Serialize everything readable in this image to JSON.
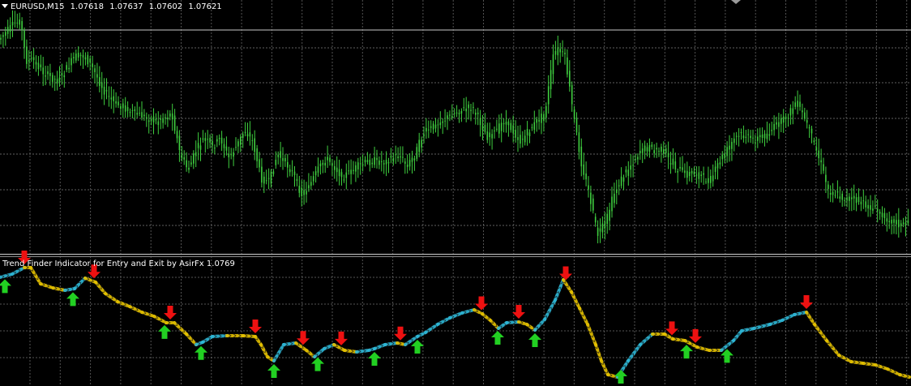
{
  "window": {
    "symbol_timeframe": "EURUSD,M15",
    "open": "1.07618",
    "high": "1.07637",
    "low": "1.07602",
    "close": "1.07621"
  },
  "indicator": {
    "label": "Trend Finder Indicator for Entry and Exit by AsirFx 1.0769"
  },
  "colors": {
    "background": "#000000",
    "grid": "#8a8a8a",
    "candles": "#3fcf3f",
    "uptrend_line": "#2eb8d8",
    "downtrend_line": "#e6c200",
    "buy_arrow": "#22d022",
    "sell_arrow": "#ee1111"
  },
  "chart_data": [
    {
      "type": "line",
      "title": "EURUSD,M15",
      "x_note": "bar index (left to right)",
      "series": [
        {
          "name": "EURUSD,M15",
          "values": [
            [
              0,
              50
            ],
            [
              10,
              40
            ],
            [
              20,
              30
            ],
            [
              28,
              25
            ],
            [
              35,
              75
            ],
            [
              45,
              75
            ],
            [
              55,
              88
            ],
            [
              65,
              95
            ],
            [
              75,
              100
            ],
            [
              85,
              85
            ],
            [
              95,
              70
            ],
            [
              105,
              68
            ],
            [
              115,
              80
            ],
            [
              125,
              100
            ],
            [
              135,
              118
            ],
            [
              145,
              128
            ],
            [
              155,
              132
            ],
            [
              165,
              138
            ],
            [
              175,
              142
            ],
            [
              185,
              145
            ],
            [
              195,
              150
            ],
            [
              205,
              145
            ],
            [
              215,
              140
            ],
            [
              225,
              190
            ],
            [
              235,
              210
            ],
            [
              245,
              185
            ],
            [
              255,
              170
            ],
            [
              265,
              182
            ],
            [
              275,
              170
            ],
            [
              285,
              195
            ],
            [
              295,
              180
            ],
            [
              305,
              160
            ],
            [
              315,
              175
            ],
            [
              325,
              220
            ],
            [
              335,
              225
            ],
            [
              345,
              190
            ],
            [
              355,
              200
            ],
            [
              365,
              215
            ],
            [
              375,
              240
            ],
            [
              385,
              228
            ],
            [
              395,
              210
            ],
            [
              405,
              195
            ],
            [
              415,
              205
            ],
            [
              425,
              218
            ],
            [
              435,
              212
            ],
            [
              445,
              205
            ],
            [
              455,
              200
            ],
            [
              465,
              198
            ],
            [
              475,
              200
            ],
            [
              485,
              196
            ],
            [
              495,
              190
            ],
            [
              505,
              205
            ],
            [
              515,
              190
            ],
            [
              525,
              165
            ],
            [
              535,
              158
            ],
            [
              545,
              150
            ],
            [
              555,
              145
            ],
            [
              565,
              138
            ],
            [
              575,
              135
            ],
            [
              585,
              132
            ],
            [
              595,
              150
            ],
            [
              605,
              170
            ],
            [
              615,
              162
            ],
            [
              625,
              148
            ],
            [
              635,
              160
            ],
            [
              645,
              175
            ],
            [
              655,
              162
            ],
            [
              665,
              150
            ],
            [
              675,
              140
            ],
            [
              685,
              72
            ],
            [
              690,
              60
            ],
            [
              700,
              70
            ],
            [
              710,
              140
            ],
            [
              720,
              200
            ],
            [
              730,
              240
            ],
            [
              740,
              290
            ],
            [
              750,
              275
            ],
            [
              760,
              240
            ],
            [
              770,
              220
            ],
            [
              780,
              205
            ],
            [
              790,
              190
            ],
            [
              800,
              182
            ],
            [
              810,
              185
            ],
            [
              820,
              185
            ],
            [
              830,
              200
            ],
            [
              840,
              210
            ],
            [
              850,
              215
            ],
            [
              860,
              212
            ],
            [
              870,
              220
            ],
            [
              880,
              222
            ],
            [
              890,
              200
            ],
            [
              900,
              185
            ],
            [
              910,
              170
            ],
            [
              920,
              165
            ],
            [
              930,
              172
            ],
            [
              940,
              170
            ],
            [
              950,
              165
            ],
            [
              960,
              155
            ],
            [
              970,
              148
            ],
            [
              980,
              135
            ],
            [
              985,
              125
            ],
            [
              995,
              145
            ],
            [
              1005,
              170
            ],
            [
              1015,
              200
            ],
            [
              1025,
              235
            ],
            [
              1035,
              240
            ],
            [
              1045,
              245
            ],
            [
              1055,
              245
            ],
            [
              1065,
              250
            ],
            [
              1075,
              255
            ],
            [
              1085,
              260
            ],
            [
              1095,
              268
            ],
            [
              1105,
              272
            ],
            [
              1115,
              278
            ],
            [
              1122,
              275
            ]
          ]
        }
      ]
    },
    {
      "type": "line",
      "title": "Trend Finder Indicator for Entry and Exit by AsirFx 1.0769",
      "series": [
        {
          "name": "Trend Finder Indicator for Entry and Exit by AsirFx 1.0769",
          "values": [
            [
              0,
              342
            ],
            [
              15,
              338
            ],
            [
              30,
              330
            ],
            [
              38,
              330
            ],
            [
              50,
              350
            ],
            [
              65,
              355
            ],
            [
              80,
              358
            ],
            [
              92,
              356
            ],
            [
              105,
              343
            ],
            [
              118,
              348
            ],
            [
              130,
              362
            ],
            [
              145,
              372
            ],
            [
              160,
              378
            ],
            [
              175,
              385
            ],
            [
              190,
              390
            ],
            [
              205,
              398
            ],
            [
              215,
              398
            ],
            [
              230,
              412
            ],
            [
              242,
              425
            ],
            [
              250,
              422
            ],
            [
              262,
              415
            ],
            [
              280,
              414
            ],
            [
              300,
              414
            ],
            [
              315,
              415
            ],
            [
              322,
              425
            ],
            [
              330,
              440
            ],
            [
              338,
              445
            ],
            [
              350,
              425
            ],
            [
              365,
              423
            ],
            [
              378,
              432
            ],
            [
              388,
              440
            ],
            [
              400,
              430
            ],
            [
              412,
              425
            ],
            [
              425,
              432
            ],
            [
              440,
              434
            ],
            [
              455,
              432
            ],
            [
              462,
              430
            ],
            [
              475,
              425
            ],
            [
              490,
              423
            ],
            [
              500,
              425
            ],
            [
              515,
              415
            ],
            [
              525,
              410
            ],
            [
              540,
              400
            ],
            [
              555,
              392
            ],
            [
              570,
              386
            ],
            [
              585,
              382
            ],
            [
              595,
              387
            ],
            [
              605,
              395
            ],
            [
              615,
              405
            ],
            [
              625,
              398
            ],
            [
              640,
              397
            ],
            [
              650,
              400
            ],
            [
              660,
              407
            ],
            [
              672,
              394
            ],
            [
              685,
              370
            ],
            [
              695,
              345
            ],
            [
              705,
              360
            ],
            [
              715,
              380
            ],
            [
              725,
              400
            ],
            [
              735,
              425
            ],
            [
              742,
              445
            ],
            [
              750,
              462
            ],
            [
              762,
              465
            ],
            [
              775,
              445
            ],
            [
              790,
              425
            ],
            [
              805,
              412
            ],
            [
              820,
              412
            ],
            [
              830,
              418
            ],
            [
              845,
              420
            ],
            [
              860,
              428
            ],
            [
              875,
              432
            ],
            [
              890,
              432
            ],
            [
              905,
              420
            ],
            [
              915,
              408
            ],
            [
              930,
              405
            ],
            [
              950,
              400
            ],
            [
              965,
              395
            ],
            [
              980,
              388
            ],
            [
              995,
              385
            ],
            [
              1005,
              400
            ],
            [
              1020,
              420
            ],
            [
              1035,
              438
            ],
            [
              1050,
              446
            ],
            [
              1065,
              448
            ],
            [
              1080,
              450
            ],
            [
              1095,
              455
            ],
            [
              1110,
              462
            ],
            [
              1122,
              465
            ]
          ]
        }
      ],
      "signals": [
        {
          "type": "buy",
          "x": 6
        },
        {
          "type": "sell",
          "x": 30
        },
        {
          "type": "buy",
          "x": 90
        },
        {
          "type": "sell",
          "x": 116
        },
        {
          "type": "buy",
          "x": 203
        },
        {
          "type": "sell",
          "x": 210
        },
        {
          "type": "buy",
          "x": 248
        },
        {
          "type": "sell",
          "x": 315
        },
        {
          "type": "buy",
          "x": 338
        },
        {
          "type": "sell",
          "x": 374
        },
        {
          "type": "buy",
          "x": 392
        },
        {
          "type": "sell",
          "x": 421
        },
        {
          "type": "buy",
          "x": 462
        },
        {
          "type": "sell",
          "x": 494
        },
        {
          "type": "buy",
          "x": 515
        },
        {
          "type": "sell",
          "x": 594
        },
        {
          "type": "buy",
          "x": 614
        },
        {
          "type": "sell",
          "x": 640
        },
        {
          "type": "buy",
          "x": 660
        },
        {
          "type": "sell",
          "x": 698
        },
        {
          "type": "buy",
          "x": 766
        },
        {
          "type": "sell",
          "x": 829
        },
        {
          "type": "buy",
          "x": 847
        },
        {
          "type": "sell",
          "x": 858
        },
        {
          "type": "buy",
          "x": 897
        },
        {
          "type": "sell",
          "x": 995
        }
      ]
    }
  ]
}
